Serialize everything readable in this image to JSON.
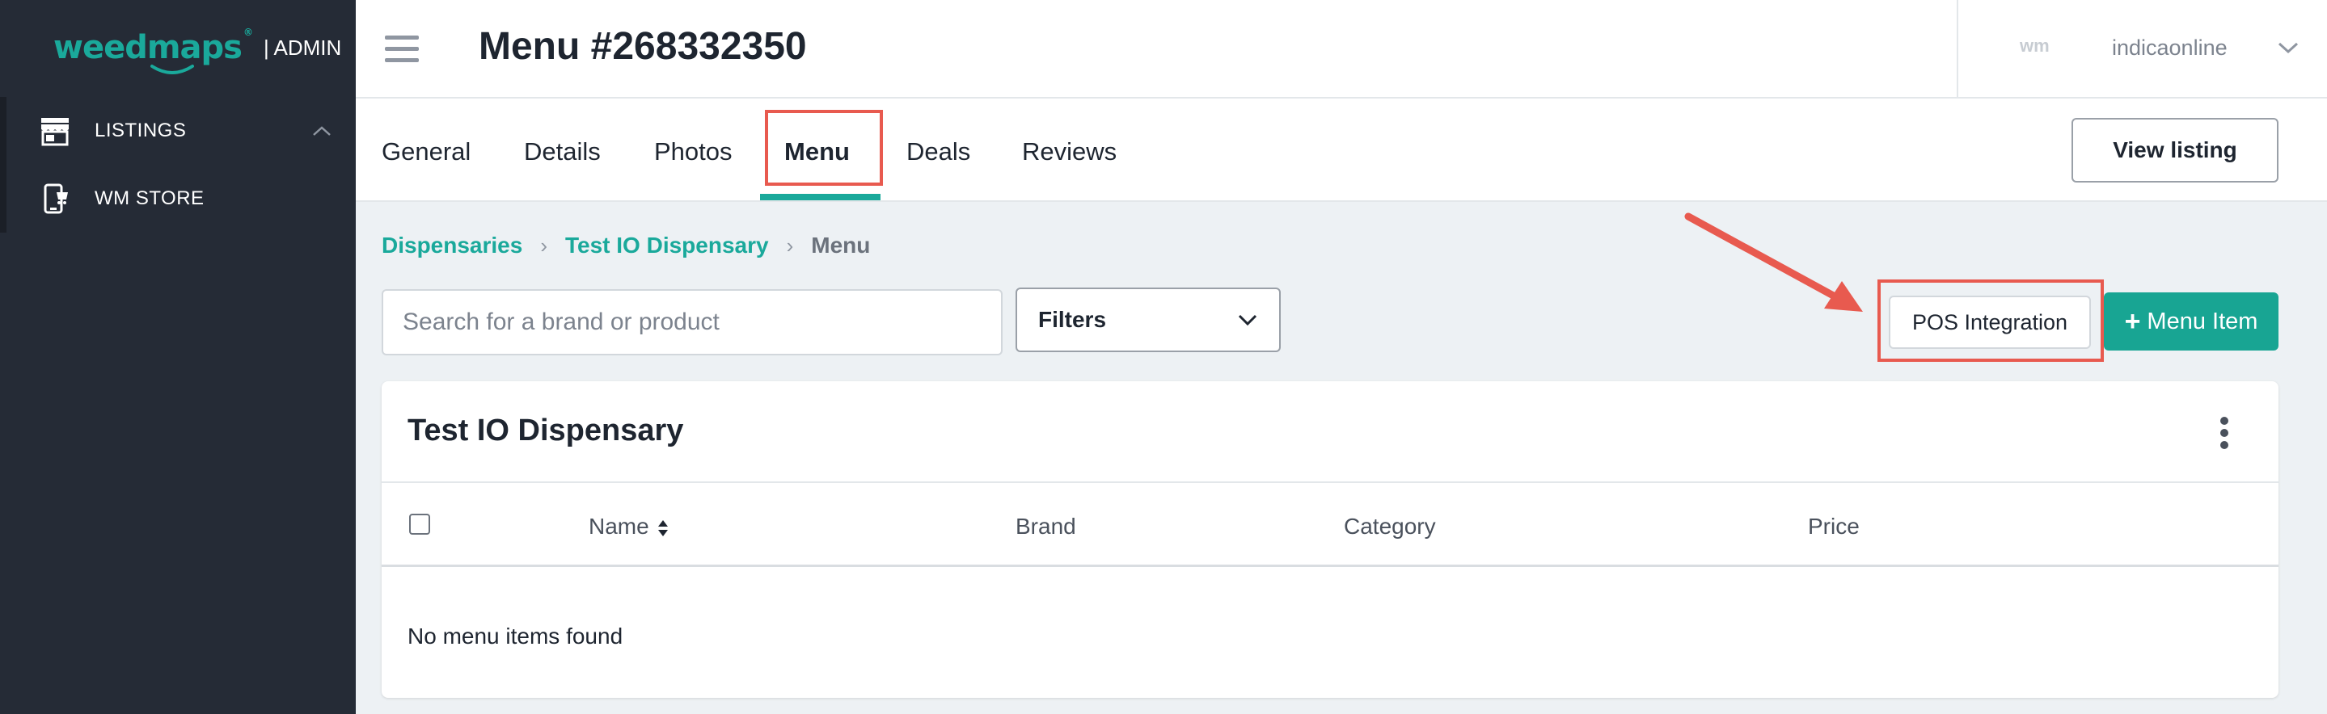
{
  "brand": {
    "logo": "weedmaps",
    "tm": "®",
    "suffix": "| ADMIN"
  },
  "sidebar": {
    "items": [
      {
        "label": "LISTINGS",
        "icon": "storefront-icon"
      },
      {
        "label": "WM STORE",
        "icon": "phone-store-icon"
      }
    ]
  },
  "header": {
    "title": "Menu #268332350",
    "wm_icon": "wm",
    "username": "indicaonline"
  },
  "tabs": [
    {
      "label": "General"
    },
    {
      "label": "Details"
    },
    {
      "label": "Photos"
    },
    {
      "label": "Menu",
      "active": true
    },
    {
      "label": "Deals"
    },
    {
      "label": "Reviews"
    }
  ],
  "view_listing_label": "View listing",
  "breadcrumb": [
    "Dispensaries",
    "Test IO Dispensary",
    "Menu"
  ],
  "search": {
    "placeholder": "Search for a brand or product",
    "value": ""
  },
  "filters_label": "Filters",
  "pos_label": "POS Integration",
  "menu_item_label": "Menu Item",
  "card": {
    "title": "Test IO Dispensary",
    "columns": [
      "Name",
      "Brand",
      "Category",
      "Price"
    ],
    "empty": "No menu items found"
  },
  "colors": {
    "accent": "#1aa99b",
    "sidebar": "#252b36",
    "highlight": "#e85a4f"
  }
}
